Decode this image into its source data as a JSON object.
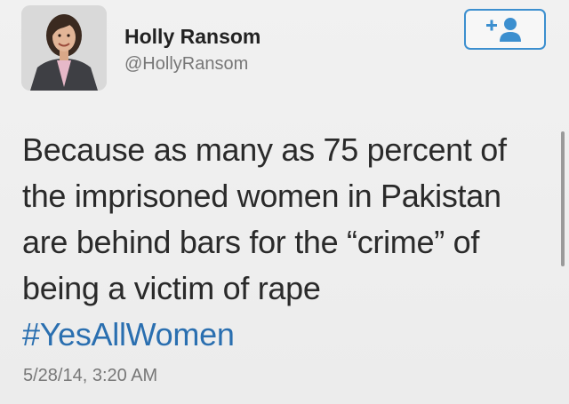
{
  "user": {
    "name": "Holly Ransom",
    "handle": "@HollyRansom",
    "avatar_icon": "profile-photo"
  },
  "follow_button": {
    "icon": "add-user-icon",
    "color": "#3c8fcf"
  },
  "tweet": {
    "lines": [
      "Because as many as 75 percent of",
      "the imprisoned women in Pakistan",
      "are behind bars for the “crime” of",
      "being a victim of rape"
    ],
    "hashtag": "#YesAllWomen",
    "hashtag_color": "#2a6fb0",
    "timestamp": "5/28/14, 3:20 AM"
  }
}
